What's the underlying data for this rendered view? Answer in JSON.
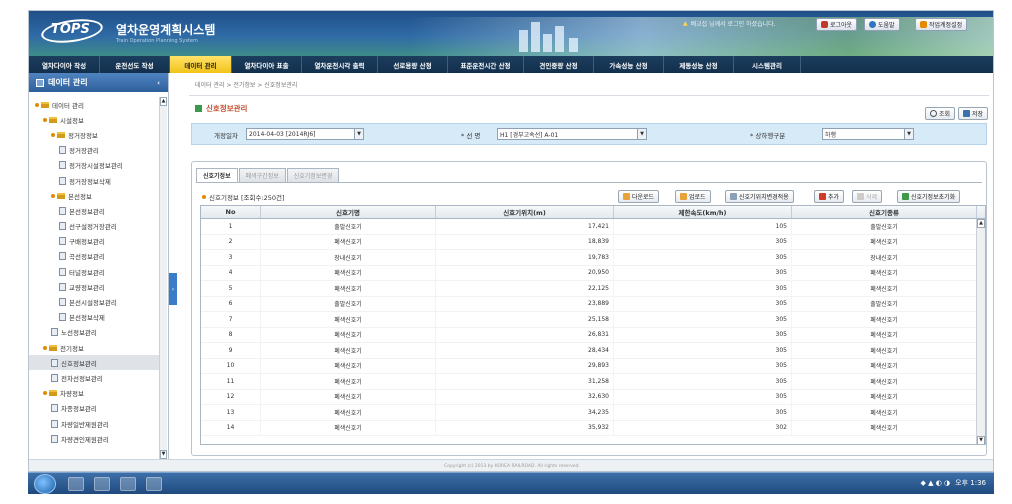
{
  "header": {
    "logo": "TOPS",
    "title": "열차운영계획시스템",
    "subtitle": "Train Operation Planning System",
    "user_info": "배교섭 님께서 로그인 하셨습니다.",
    "buttons": [
      "로그아웃",
      "도움말",
      "작업계정설정"
    ]
  },
  "menu": [
    {
      "label": "열차다이아 작성",
      "width": 71
    },
    {
      "label": "운전선도 작성",
      "width": 70
    },
    {
      "label": "데이터 관리",
      "width": 62,
      "active": true
    },
    {
      "label": "열차다이아 표출",
      "width": 70
    },
    {
      "label": "열차운전시각 출력",
      "width": 76
    },
    {
      "label": "선로용량 산정",
      "width": 70
    },
    {
      "label": "표준운전시간 산정",
      "width": 76
    },
    {
      "label": "견인중량 산정",
      "width": 70
    },
    {
      "label": "가속성능 산정",
      "width": 70
    },
    {
      "label": "제동성능 산정",
      "width": 70
    },
    {
      "label": "시스템관리",
      "width": 67
    }
  ],
  "sidebar": {
    "title": "데이터 관리",
    "items": [
      {
        "label": "데이터 관리",
        "type": "folder",
        "level": 0
      },
      {
        "label": "시설정보",
        "type": "folder",
        "level": 1
      },
      {
        "label": "정거장정보",
        "type": "folder",
        "level": 2
      },
      {
        "label": "정거장관리",
        "type": "page",
        "level": 3
      },
      {
        "label": "정거장시설정보관리",
        "type": "page",
        "level": 3
      },
      {
        "label": "정거장정보삭제",
        "type": "page",
        "level": 3
      },
      {
        "label": "본선정보",
        "type": "folder",
        "level": 2
      },
      {
        "label": "본선정보관리",
        "type": "page",
        "level": 3
      },
      {
        "label": "선구설정거장관리",
        "type": "page",
        "level": 3
      },
      {
        "label": "구배정보관리",
        "type": "page",
        "level": 3
      },
      {
        "label": "곡선정보관리",
        "type": "page",
        "level": 3
      },
      {
        "label": "터널정보관리",
        "type": "page",
        "level": 3
      },
      {
        "label": "교량정보관리",
        "type": "page",
        "level": 3
      },
      {
        "label": "본선시설정보관리",
        "type": "page",
        "level": 3
      },
      {
        "label": "본선정보삭제",
        "type": "page",
        "level": 3
      },
      {
        "label": "노선정보관리",
        "type": "page",
        "level": 2
      },
      {
        "label": "전기정보",
        "type": "folder",
        "level": 1
      },
      {
        "label": "신호정보관리",
        "type": "page",
        "level": 2,
        "selected": true
      },
      {
        "label": "전차선정보관리",
        "type": "page",
        "level": 2
      },
      {
        "label": "차량정보",
        "type": "folder",
        "level": 1
      },
      {
        "label": "차종정보관리",
        "type": "page",
        "level": 2
      },
      {
        "label": "차량일반제원관리",
        "type": "page",
        "level": 2
      },
      {
        "label": "차량견인제원관리",
        "type": "page",
        "level": 2
      }
    ]
  },
  "breadcrumb": "데이터 관리 > 전기정보 > 신호정보관리",
  "page_title": "신호정보관리",
  "top_buttons": [
    "조회",
    "저장"
  ],
  "filters": {
    "date_label": "개정일자",
    "date_value": "2014-04-03 [2014RJ6]",
    "line_label": "* 선    명",
    "line_value": "H1 [경부고속선] A-01",
    "direction_label": "* 상하행구분",
    "direction_value": "하행"
  },
  "tabs": [
    "신호기정보",
    "폐색구간정보",
    "신호기정보변경"
  ],
  "count_label": "신호기정보 [조회수:250건]",
  "action_buttons": [
    "다운로드",
    "업로드",
    "신호기위치변경적용",
    "추가",
    "삭제",
    "신호기정보초기화"
  ],
  "table": {
    "columns": [
      "No",
      "신호기명",
      "신호기위치(m)",
      "제한속도(km/h)",
      "신호기종류"
    ],
    "rows": [
      [
        "1",
        "출발신호기",
        "17,421",
        "105",
        "출발신호기"
      ],
      [
        "2",
        "폐색신호기",
        "18,839",
        "305",
        "폐색신호기"
      ],
      [
        "3",
        "장내신호기",
        "19,783",
        "305",
        "장내신호기"
      ],
      [
        "4",
        "폐색신호기",
        "20,950",
        "305",
        "폐색신호기"
      ],
      [
        "5",
        "폐색신호기",
        "22,125",
        "305",
        "폐색신호기"
      ],
      [
        "6",
        "출발신호기",
        "23,889",
        "305",
        "출발신호기"
      ],
      [
        "7",
        "폐색신호기",
        "25,158",
        "305",
        "폐색신호기"
      ],
      [
        "8",
        "폐색신호기",
        "26,831",
        "305",
        "폐색신호기"
      ],
      [
        "9",
        "폐색신호기",
        "28,434",
        "305",
        "폐색신호기"
      ],
      [
        "10",
        "폐색신호기",
        "29,893",
        "305",
        "폐색신호기"
      ],
      [
        "11",
        "폐색신호기",
        "31,258",
        "305",
        "폐색신호기"
      ],
      [
        "12",
        "폐색신호기",
        "32,630",
        "305",
        "폐색신호기"
      ],
      [
        "13",
        "폐색신호기",
        "34,235",
        "305",
        "폐색신호기"
      ],
      [
        "14",
        "폐색신호기",
        "35,932",
        "302",
        "폐색신호기"
      ]
    ]
  },
  "footer": "Copyright (c) 2013 by KOREA RAILROAD. All rights reserved.",
  "taskbar": {
    "time": "오후 1:36"
  }
}
